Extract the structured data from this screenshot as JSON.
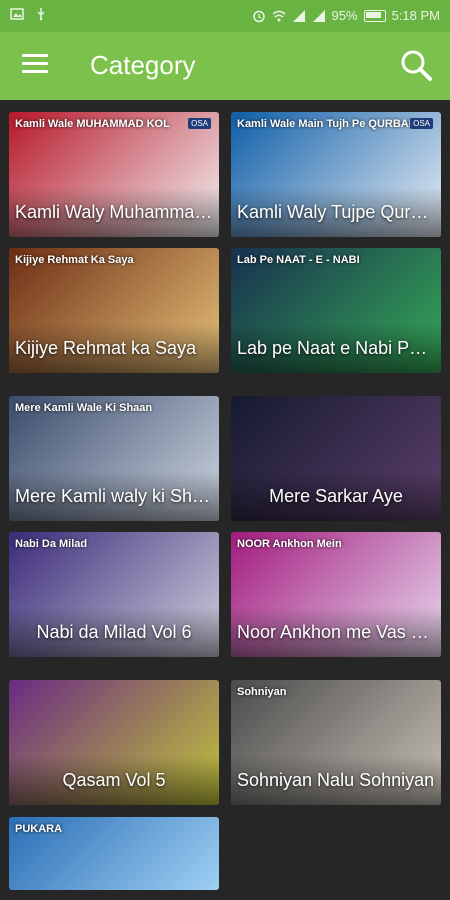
{
  "status": {
    "battery": "95%",
    "time": "5:18 PM"
  },
  "appbar": {
    "title": "Category"
  },
  "cards": [
    {
      "label": "Kamli Waly Muhammad Kol",
      "banner": "Kamli Wale MUHAMMAD KOL",
      "bg1": "#b7182a",
      "bg2": "#f3f3f3"
    },
    {
      "label": "Kamli Waly Tujpe Qurban",
      "banner": "Kamli Wale Main Tujh Pe QURBAN",
      "bg1": "#0e5ea8",
      "bg2": "#e9eef5"
    },
    {
      "label": "Kijiye Rehmat ka Saya",
      "banner": "Kijiye Rehmat Ka Saya",
      "bg1": "#6d2d14",
      "bg2": "#e7c27a"
    },
    {
      "label": "Lab pe Naat e Nabi Paak",
      "banner": "Lab Pe NAAT - E - NABI",
      "bg1": "#17314f",
      "bg2": "#35a855"
    },
    {
      "label": "Mere Kamli waly ki Shaan",
      "banner": "Mere Kamli Wale Ki Shaan",
      "bg1": "#3a4a6a",
      "bg2": "#cfd7e3"
    },
    {
      "label": "Mere Sarkar Aye",
      "banner": "",
      "bg1": "#151a2f",
      "bg2": "#5c3f6a"
    },
    {
      "label": "Nabi da Milad Vol 6",
      "banner": "Nabi Da Milad",
      "bg1": "#3b2a7a",
      "bg2": "#d1d0dd"
    },
    {
      "label": "Noor Ankhon me Vas Gaya",
      "banner": "NOOR Ankhon Mein",
      "bg1": "#a21b7e",
      "bg2": "#e8d9ee"
    },
    {
      "label": "Qasam Vol 5",
      "banner": "",
      "bg1": "#6a2b82",
      "bg2": "#c2c53a"
    },
    {
      "label": "Sohniyan Nalu Sohniyan",
      "banner": "Sohniyan",
      "bg1": "#4b4b4b",
      "bg2": "#c8c1b7"
    },
    {
      "label": "",
      "banner": "PUKARA",
      "bg1": "#2a6eb5",
      "bg2": "#9fd0f4"
    }
  ]
}
